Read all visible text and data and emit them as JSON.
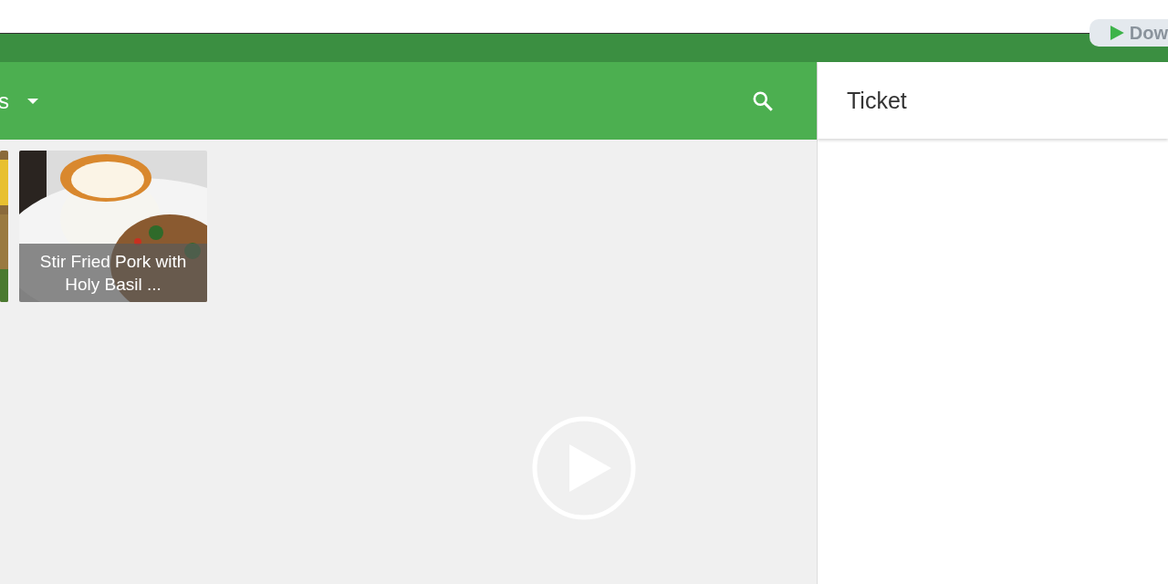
{
  "header": {
    "title": "s"
  },
  "dishes": [
    {
      "kind": "partial"
    },
    {
      "kind": "full",
      "name": "Stir Fried Pork with Holy Basil ..."
    }
  ],
  "ticket": {
    "title": "Ticket"
  },
  "download_button": {
    "label": "Dow"
  }
}
